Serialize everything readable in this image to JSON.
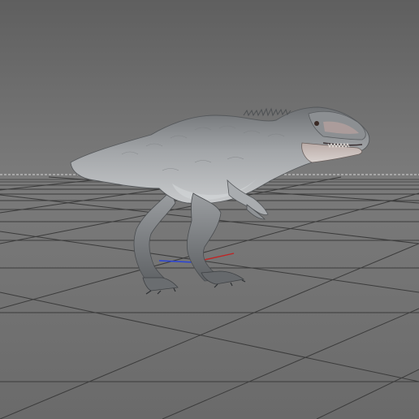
{
  "viewport": {
    "kind": "3d-perspective-viewport",
    "background_colors": [
      "#626262",
      "#7a7a7a"
    ],
    "grid": {
      "visible": true,
      "line_color": "#3a3a3a",
      "horizon_color": "#d8d8d8"
    },
    "axis_gizmo": {
      "x_color": "#c02424",
      "y_color": "#1fb81f",
      "z_color": "#2a44d8"
    },
    "model": {
      "subject": "theropod-dinosaur",
      "base_color": "#9a9c9e",
      "jaw_tint": "#c9b8b0"
    }
  }
}
